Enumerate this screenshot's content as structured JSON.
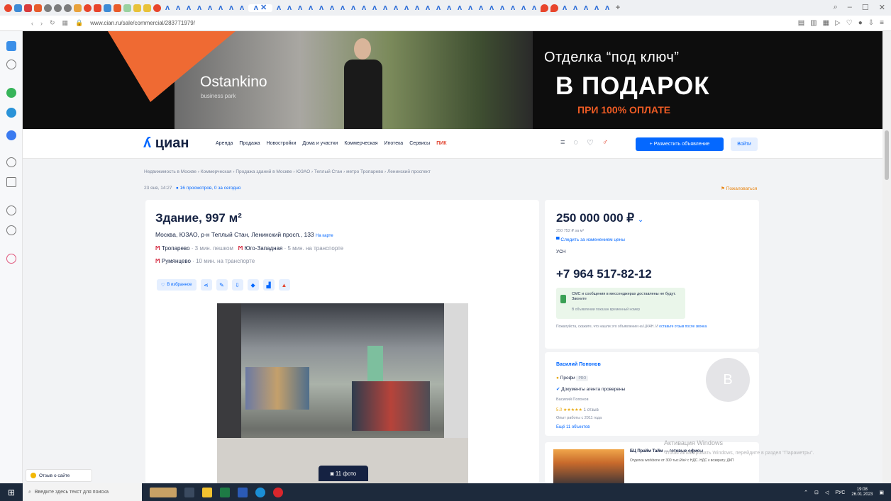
{
  "browser": {
    "url": "www.cian.ru/sale/commercial/283771979/"
  },
  "banner": {
    "logo": "Ostankino",
    "logo_sub": "business park",
    "headline1": "Отделка “под ключ”",
    "headline2": "В ПОДАРОК",
    "headline3": "ПРИ 100% ОПЛАТЕ"
  },
  "header": {
    "logo": "циан",
    "nav": [
      "Аренда",
      "Продажа",
      "Новостройки",
      "Дома и участки",
      "Коммерческая",
      "Ипотека",
      "Сервисы",
      "ПИК"
    ],
    "post_button": "+ Разместить объявление",
    "login_button": "Войти"
  },
  "breadcrumbs": "Недвижимость в Москве  ›  Коммерческая  ›  Продажа зданий в Москве  ›  ЮЗАО  ›  Теплый Стан  ›  метро Тропарево  ›  Ленинский проспект",
  "meta": {
    "date": "23 янв, 14:27",
    "views": "16 просмотров, 0 за сегодня",
    "complain": "Пожаловаться"
  },
  "listing": {
    "title": "Здание, 997 м²",
    "address": "Москва, ЮЗАО, р-н Теплый Стан, Ленинский просп., 133",
    "map_link": "На карте",
    "metro": [
      {
        "name": "Тропарево",
        "time": "· 3 мин. пешком"
      },
      {
        "name": "Юго-Западная",
        "time": "· 5 мин. на транспорте"
      },
      {
        "name": "Румянцево",
        "time": "· 10 мин. на транспорте"
      }
    ],
    "favorite": "В избранное",
    "photo_count": "11 фото"
  },
  "price_card": {
    "price": "250 000 000 ₽",
    "price_per_m": "250 752 ₽ за м²",
    "follow": "Следить за изменением цены",
    "tax": "УСН",
    "phone": "+7 964 517-82-12",
    "sms_title": "СМС и сообщения в мессенджерах доставлены не будут. Звоните",
    "sms_sub": "В объявлении показан временный номер",
    "note": "Пожалуйста, скажите, что нашли это объявление на ЦИАН. И",
    "note_link": "оставьте отзыв после звонка"
  },
  "agent": {
    "name": "Василий Попонов",
    "pro": "Профи",
    "pro_badge": "PRO",
    "verified": "Документы агента проверены",
    "sub_name": "Василий Попонов",
    "rating": "5.0 ★★★★★",
    "reviews": "1 отзыв",
    "experience": "Опыт работы с 2011 года",
    "more": "Ещё 11 объектов",
    "avatar_letter": "В"
  },
  "ad": {
    "title": "БЦ Прайм Тайм — готовые офисы",
    "text": "Отделка workbone от 300 тыс.₽/м² с НДС. НДС к возврату. ДКП"
  },
  "windows": {
    "activation": "Активация Windows",
    "activation_sub": "Чтобы активировать Windows, перейдите в раздел \"Параметры\"."
  },
  "feedback": "Отзыв о сайте",
  "taskbar": {
    "search": "Введите здесь текст для поиска",
    "lang": "РУС",
    "time": "19:08",
    "date": "26.01.2023"
  }
}
